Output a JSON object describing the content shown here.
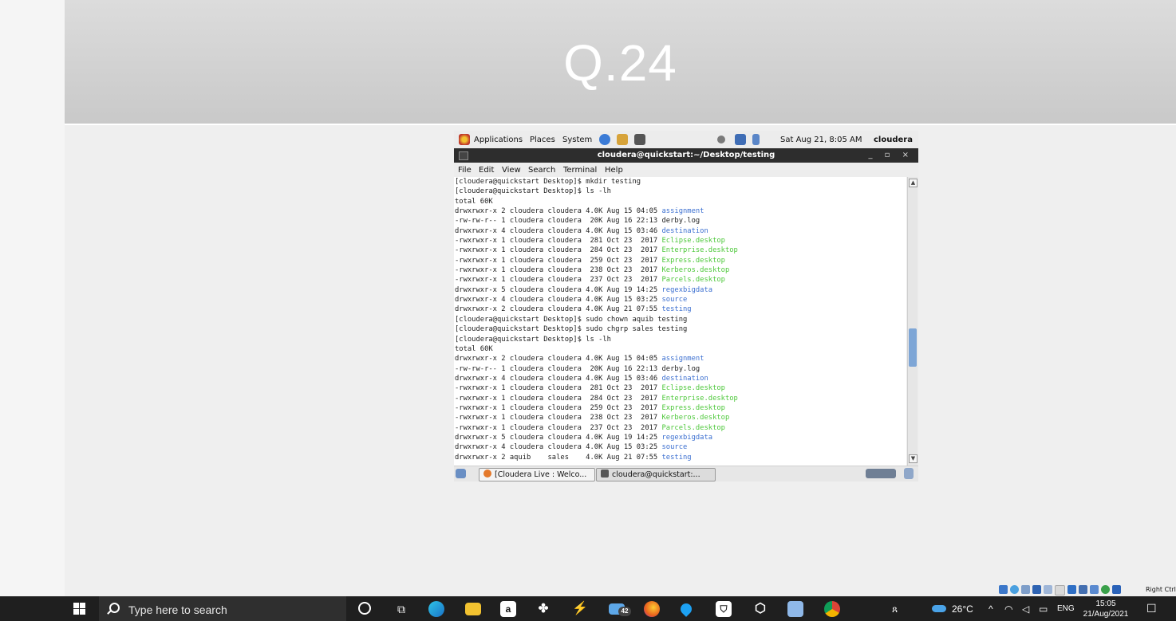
{
  "slide": {
    "title": "Q.24"
  },
  "vm": {
    "top_panel": {
      "applications": "Applications",
      "places": "Places",
      "system": "System",
      "datetime": "Sat Aug 21, 8:05 AM",
      "user": "cloudera"
    },
    "window": {
      "title": "cloudera@quickstart:~/Desktop/testing",
      "controls": "_ ▫ ×"
    },
    "menu": [
      "File",
      "Edit",
      "View",
      "Search",
      "Terminal",
      "Help"
    ],
    "terminal_lines": [
      {
        "text": "[cloudera@quickstart Desktop]$ mkdir testing"
      },
      {
        "text": "[cloudera@quickstart Desktop]$ ls -lh"
      },
      {
        "text": "total 60K"
      },
      {
        "text": "drwxrwxr-x 2 cloudera cloudera 4.0K Aug 15 04:05 ",
        "name": "assignment",
        "color": "blue"
      },
      {
        "text": "-rw-rw-r-- 1 cloudera cloudera  20K Aug 16 22:13 derby.log"
      },
      {
        "text": "drwxrwxr-x 4 cloudera cloudera 4.0K Aug 15 03:46 ",
        "name": "destination",
        "color": "blue"
      },
      {
        "text": "-rwxrwxr-x 1 cloudera cloudera  281 Oct 23  2017 ",
        "name": "Eclipse.desktop",
        "color": "green"
      },
      {
        "text": "-rwxrwxr-x 1 cloudera cloudera  284 Oct 23  2017 ",
        "name": "Enterprise.desktop",
        "color": "green"
      },
      {
        "text": "-rwxrwxr-x 1 cloudera cloudera  259 Oct 23  2017 ",
        "name": "Express.desktop",
        "color": "green"
      },
      {
        "text": "-rwxrwxr-x 1 cloudera cloudera  238 Oct 23  2017 ",
        "name": "Kerberos.desktop",
        "color": "green"
      },
      {
        "text": "-rwxrwxr-x 1 cloudera cloudera  237 Oct 23  2017 ",
        "name": "Parcels.desktop",
        "color": "green"
      },
      {
        "text": "drwxrwxr-x 5 cloudera cloudera 4.0K Aug 19 14:25 ",
        "name": "regexbigdata",
        "color": "blue"
      },
      {
        "text": "drwxrwxr-x 4 cloudera cloudera 4.0K Aug 15 03:25 ",
        "name": "source",
        "color": "blue"
      },
      {
        "text": "drwxrwxr-x 2 cloudera cloudera 4.0K Aug 21 07:55 ",
        "name": "testing",
        "color": "blue"
      },
      {
        "text": "[cloudera@quickstart Desktop]$ sudo chown aquib testing"
      },
      {
        "text": "[cloudera@quickstart Desktop]$ sudo chgrp sales testing"
      },
      {
        "text": "[cloudera@quickstart Desktop]$ ls -lh"
      },
      {
        "text": "total 60K"
      },
      {
        "text": "drwxrwxr-x 2 cloudera cloudera 4.0K Aug 15 04:05 ",
        "name": "assignment",
        "color": "blue"
      },
      {
        "text": "-rw-rw-r-- 1 cloudera cloudera  20K Aug 16 22:13 derby.log"
      },
      {
        "text": "drwxrwxr-x 4 cloudera cloudera 4.0K Aug 15 03:46 ",
        "name": "destination",
        "color": "blue"
      },
      {
        "text": "-rwxrwxr-x 1 cloudera cloudera  281 Oct 23  2017 ",
        "name": "Eclipse.desktop",
        "color": "green"
      },
      {
        "text": "-rwxrwxr-x 1 cloudera cloudera  284 Oct 23  2017 ",
        "name": "Enterprise.desktop",
        "color": "green"
      },
      {
        "text": "-rwxrwxr-x 1 cloudera cloudera  259 Oct 23  2017 ",
        "name": "Express.desktop",
        "color": "green"
      },
      {
        "text": "-rwxrwxr-x 1 cloudera cloudera  238 Oct 23  2017 ",
        "name": "Kerberos.desktop",
        "color": "green"
      },
      {
        "text": "-rwxrwxr-x 1 cloudera cloudera  237 Oct 23  2017 ",
        "name": "Parcels.desktop",
        "color": "green"
      },
      {
        "text": "drwxrwxr-x 5 cloudera cloudera 4.0K Aug 19 14:25 ",
        "name": "regexbigdata",
        "color": "blue"
      },
      {
        "text": "drwxrwxr-x 4 cloudera cloudera 4.0K Aug 15 03:25 ",
        "name": "source",
        "color": "blue"
      },
      {
        "text": "drwxrwxr-x 2 aquib    sales    4.0K Aug 21 07:55 ",
        "name": "testing",
        "color": "blue"
      }
    ],
    "bottom_panel": {
      "task1": "[Cloudera Live : Welco...",
      "task2": "cloudera@quickstart:..."
    }
  },
  "vbox_status": {
    "host_key": "Right Ctrl"
  },
  "taskbar": {
    "search_placeholder": "Type here to search",
    "weather": "26°C",
    "language": "ENG",
    "time": "15:05",
    "date": "21/Aug/2021",
    "badge_count": "42",
    "icons": [
      "cortana-icon",
      "task-view-icon",
      "edge-icon",
      "file-explorer-icon",
      "amazon-icon",
      "dropbox-icon",
      "visual-studio-icon",
      "mail-icon",
      "firefox-icon",
      "location-icon",
      "store-icon",
      "virtualbox-icon",
      "app-icon",
      "chrome-icon"
    ]
  },
  "colors": {
    "dir": "#3b6fd0",
    "exec": "#4ec83b",
    "taskbar": "#1f1f1f"
  }
}
